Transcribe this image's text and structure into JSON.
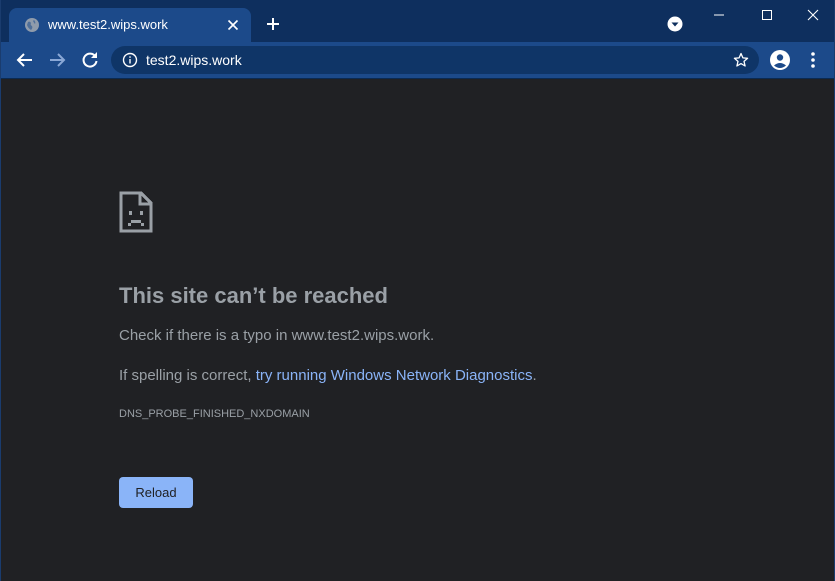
{
  "tab": {
    "title": "www.test2.wips.work"
  },
  "omnibox": {
    "url": "test2.wips.work"
  },
  "error_page": {
    "heading": "This site can’t be reached",
    "check_text": "Check if there is a typo in www.test2.wips.work.",
    "spelling_prefix": "If spelling is correct, ",
    "diagnostics_link": "try running Windows Network Diagnostics",
    "spelling_suffix": ".",
    "error_code": "DNS_PROBE_FINISHED_NXDOMAIN",
    "reload_label": "Reload"
  },
  "icons": {
    "tab_favicon": "globe-icon",
    "tab_close": "close-icon",
    "new_tab": "plus-icon",
    "tab_search": "chevron-down-circle-icon",
    "window_minimize": "minimize-icon",
    "window_maximize": "maximize-icon",
    "window_close": "close-icon",
    "back": "arrow-left-icon",
    "forward": "arrow-right-icon",
    "reload": "reload-icon",
    "site_info": "info-icon",
    "bookmark": "star-icon",
    "profile": "person-icon",
    "menu": "kebab-menu-icon",
    "error": "sad-page-icon"
  },
  "colors": {
    "frame": "#0e2f5e",
    "toolbar": "#1c4a8a",
    "omnibox": "#0f3567",
    "page_background": "#202124",
    "text": "#9aa0a6",
    "link": "#8ab4f8",
    "button": "#8ab4f8"
  }
}
